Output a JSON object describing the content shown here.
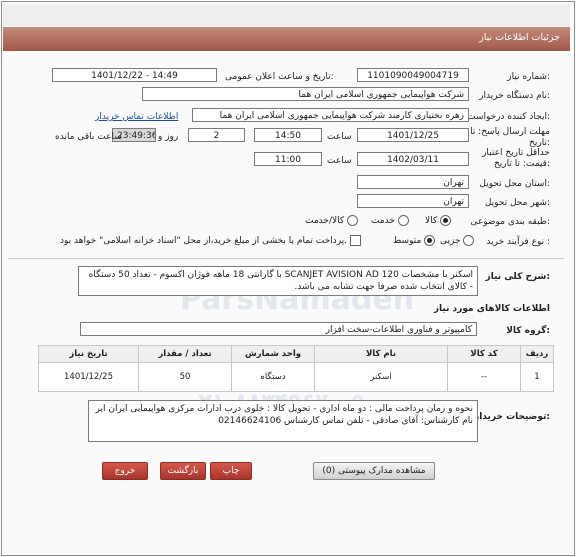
{
  "header": {
    "title": "جزئیات اطلاعات نیاز"
  },
  "need_number": {
    "label": "شماره نیاز:",
    "value": "1101090049004719"
  },
  "announce": {
    "label": "تاریخ و ساعت اعلان عمومی:",
    "value": "1401/12/22 - 14:49"
  },
  "buyer": {
    "label": "نام دستگاه خریدار:",
    "value": "شرکت هواپیمایی جمهوری اسلامی ایران هما"
  },
  "creator": {
    "label": "ایجاد کننده درخواست:",
    "value": "زهره بختیاری کارمند شرکت هواپیمایی جمهوری اسلامی ایران هما",
    "contact_link": "اطلاعات تماس خریدار"
  },
  "deadline": {
    "label": "مهلت ارسال پاسخ: تا تاریخ:",
    "date": "1401/12/25",
    "time_label": "ساعت",
    "time": "14:50",
    "days": "2",
    "days_label": "روز و",
    "remaining": "23:49:36",
    "remaining_label": "ساعت باقی مانده"
  },
  "validity": {
    "label": "حداقل تاریخ اعتبار قیمت: تا تاریخ:",
    "date": "1402/03/11",
    "time_label": "ساعت",
    "time": "11:00"
  },
  "province": {
    "label": "استان محل تحویل:",
    "value": "تهران"
  },
  "city": {
    "label": "شهر محل تحویل:",
    "value": "تهران"
  },
  "category": {
    "label": "طبقه بندی موضوعی:",
    "options": [
      "کالا",
      "خدمت",
      "کالا/خدمت"
    ],
    "selected": "کالا"
  },
  "process": {
    "label": "نوع فرآیند خرید :",
    "options": [
      "جزیی",
      "متوسط"
    ],
    "selected": "متوسط",
    "note": "پرداخت تمام یا بخشی از مبلغ خرید،از محل \"اسناد خزانه اسلامی\" خواهد بود."
  },
  "summary": {
    "label": "شرح کلی نیاز:",
    "text": "اسکنر با مشخصات SCANJET AVISION AD 120 با گارانتی 18 ماهه فوژان اکسوم - تعداد 50 دستگاه - کالای انتخاب شده صرفا جهت تشابه می باشد."
  },
  "goods_info": {
    "title": "اطلاعات کالاهای مورد نیاز"
  },
  "goods_group": {
    "label": "گروه کالا:",
    "value": "کامپیوتر و فناوری اطلاعات-سخت افزار"
  },
  "items_table": {
    "headers": [
      "ردیف",
      "کد کالا",
      "نام کالا",
      "واحد شمارش",
      "تعداد / مقدار",
      "تاریخ نیاز"
    ],
    "rows": [
      [
        "1",
        "--",
        "اسکنر",
        "دستگاه",
        "50",
        "1401/12/25"
      ]
    ]
  },
  "buyer_notes": {
    "label": "توضیحات خریدار:",
    "text": "نحوه و زمان پرداخت مالی : دو ماه اداری - تحویل کالا : خلوی درب ادارات مرکزی هواپیمایی ایران ایر نام کارشناس: آقای صادقی - تلفن تماس کارشناس 02146624106"
  },
  "buttons": {
    "view_docs": "مشاهده مدارک پیوستی (0)",
    "print": "چاپ",
    "back": "بازگشت",
    "exit": "خروج"
  },
  "watermark": {
    "brand": "ParsNamadeh",
    "phone": "۰۲۱-۸۸۳۴۹۶۷۰-۵"
  }
}
